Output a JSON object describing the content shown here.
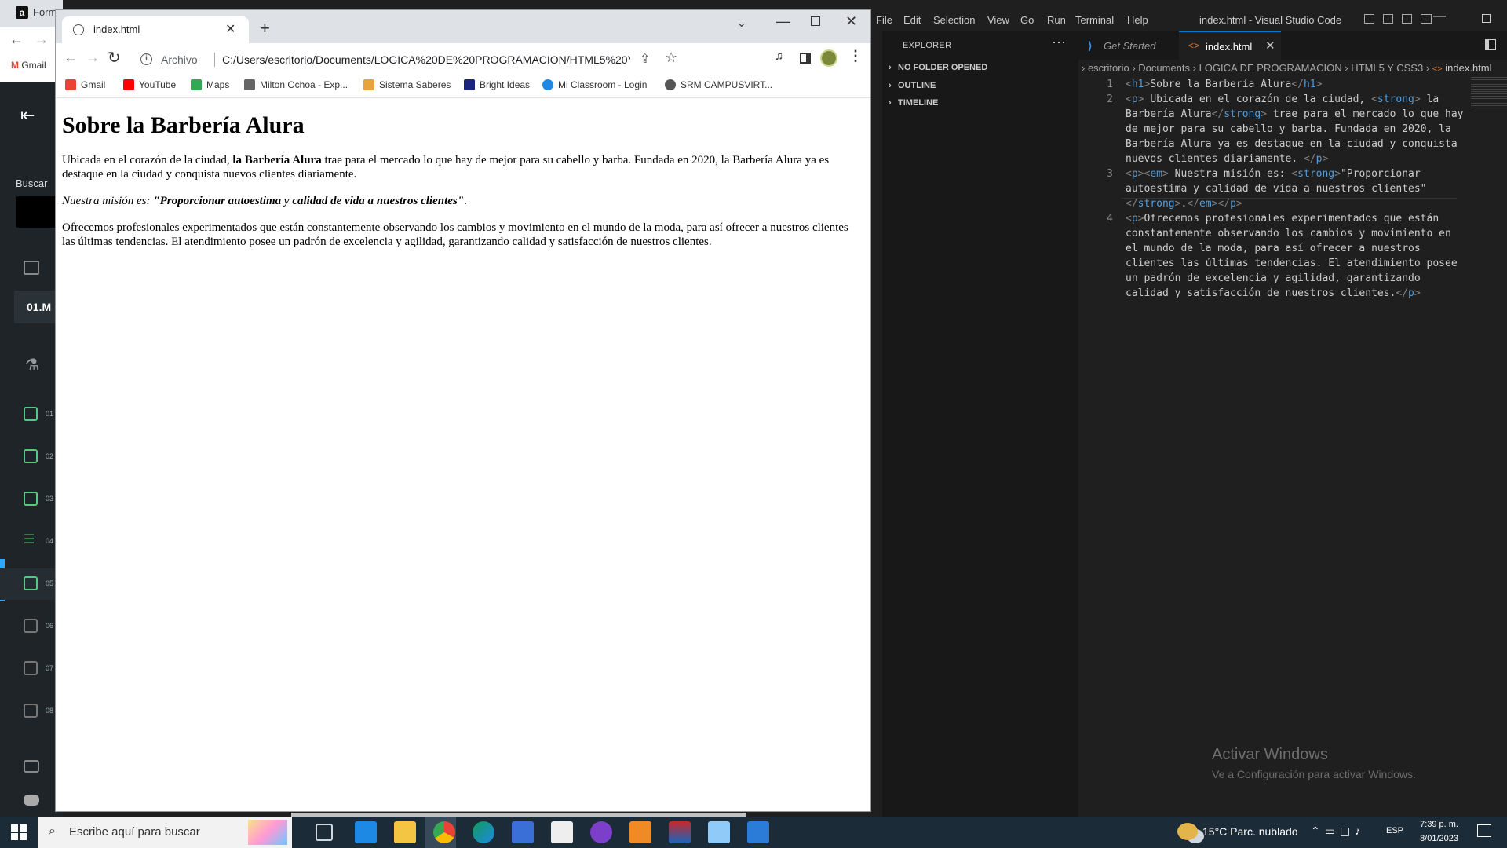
{
  "background_browser": {
    "tab_label": "Form",
    "tab_icon_letter": "a",
    "gmail_label": "Gmail",
    "search_label": "Buscar",
    "course_label": "01.M",
    "nav_numbers": [
      "01",
      "02",
      "03",
      "04",
      "05",
      "06",
      "07",
      "08"
    ]
  },
  "chrome": {
    "tab_title": "index.html",
    "scheme_label": "Archivo",
    "url": "C:/Users/escritorio/Documents/LOGICA%20DE%20PROGRAMACION/HTML5%20Y%20CSS3/index.h...",
    "bookmarks": [
      {
        "label": "Gmail",
        "color": "#ea4335"
      },
      {
        "label": "YouTube",
        "color": "#ff0000"
      },
      {
        "label": "Maps",
        "color": "#34a853"
      },
      {
        "label": "Milton Ochoa - Exp...",
        "color": "#666666"
      },
      {
        "label": "Sistema Saberes",
        "color": "#e8a33a"
      },
      {
        "label": "Bright Ideas",
        "color": "#1a237e"
      },
      {
        "label": "Mi Classroom - Login",
        "color": "#1e88e5"
      },
      {
        "label": "SRM CAMPUSVIRT...",
        "color": "#555555"
      }
    ]
  },
  "page": {
    "heading": "Sobre la Barbería Alura",
    "p1_before": "Ubicada en el corazón de la ciudad, ",
    "p1_strong": "la Barbería Alura",
    "p1_after": " trae para el mercado lo que hay de mejor para su cabello y barba. Fundada en 2020, la Barbería Alura ya es destaque en la ciudad y conquista nuevos clientes diariamente.",
    "p2_em": "Nuestra misión es: ",
    "p2_strong": "\"Proporcionar autoestima y calidad de vida a nuestros clientes\"",
    "p2_end": ".",
    "p3": "Ofrecemos profesionales experimentados que están constantemente observando los cambios y movimiento en el mundo de la moda, para así ofrecer a nuestros clientes las últimas tendencias. El atendimiento posee un padrón de excelencia y agilidad, garantizando calidad y satisfacción de nuestros clientes."
  },
  "vscode": {
    "menu": [
      "File",
      "Edit",
      "Selection",
      "View",
      "Go",
      "Run",
      "Terminal",
      "Help"
    ],
    "window_title": "index.html - Visual Studio Code",
    "explorer_title": "EXPLORER",
    "explorer_sections": [
      "NO FOLDER OPENED",
      "OUTLINE",
      "TIMELINE"
    ],
    "tab_get_started": "Get Started",
    "tab_index": "index.html",
    "breadcrumb": [
      "escritorio",
      "Documents",
      "LOGICA DE PROGRAMACION",
      "HTML5 Y CSS3",
      "index.html"
    ],
    "line_numbers": [
      "1",
      "2",
      "3",
      "4"
    ],
    "activate_title": "Activar Windows",
    "activate_sub": "Ve a Configuración para activar Windows."
  },
  "taskbar": {
    "search_placeholder": "Escribe aquí para buscar",
    "weather": "15°C  Parc. nublado",
    "language": "ESP",
    "time": "7:39 p. m.",
    "date": "8/01/2023"
  }
}
